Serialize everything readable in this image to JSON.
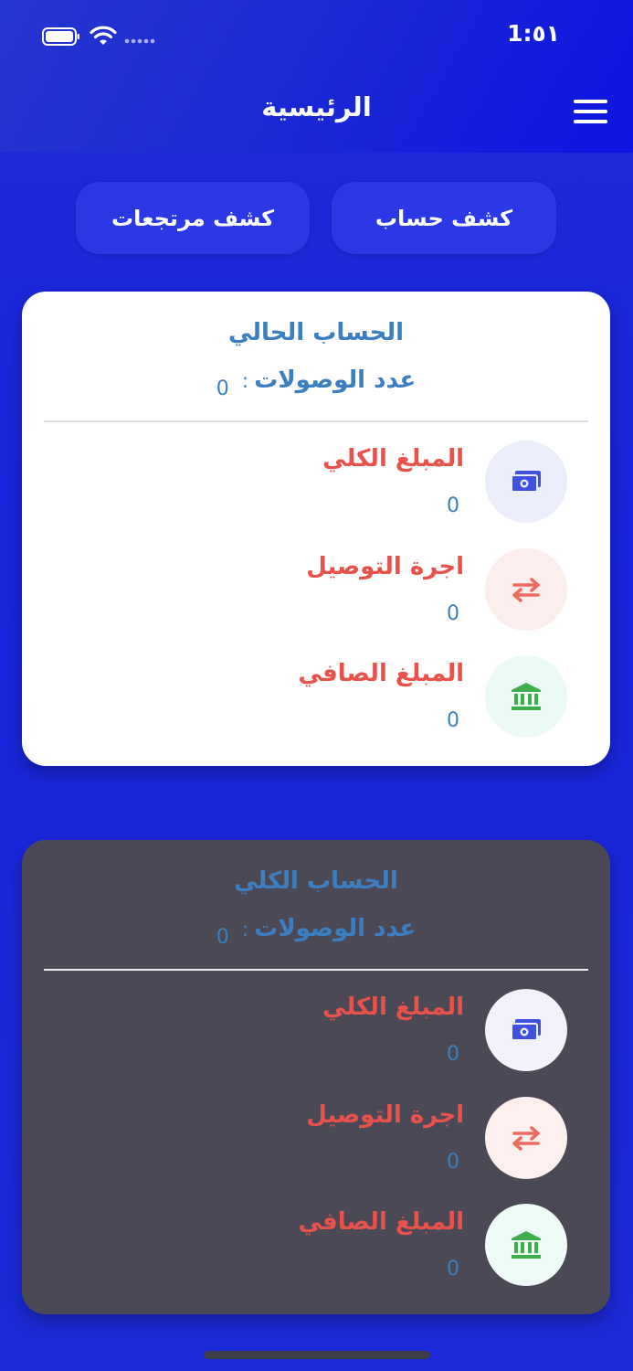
{
  "status_bar": {
    "time": "1:٥١"
  },
  "header": {
    "title": "الرئيسية"
  },
  "actions": {
    "account_statement": "كشف حساب",
    "returns_statement": "كشف مرتجعات"
  },
  "current_account": {
    "title": "الحساب الحالي",
    "receipts_label": "عدد الوصولات",
    "receipts_colon": ":",
    "receipts_value": "0",
    "rows": [
      {
        "label": "المبلغ الكلي",
        "value": "0",
        "icon": "cash-icon"
      },
      {
        "label": "اجرة التوصيل",
        "value": "0",
        "icon": "transfer-arrows-icon"
      },
      {
        "label": "المبلغ الصافي",
        "value": "0",
        "icon": "bank-icon"
      }
    ]
  },
  "total_account": {
    "title": "الحساب الكلي",
    "receipts_label": "عدد الوصولات",
    "receipts_colon": ":",
    "receipts_value": "0",
    "rows": [
      {
        "label": "المبلغ الكلي",
        "value": "0",
        "icon": "cash-icon"
      },
      {
        "label": "اجرة التوصيل",
        "value": "0",
        "icon": "transfer-arrows-icon"
      },
      {
        "label": "المبلغ الصافي",
        "value": "0",
        "icon": "bank-icon"
      }
    ]
  },
  "colors": {
    "background": "#1a24d6",
    "button": "#2b38e6",
    "label_red": "#e9514b",
    "value_blue": "#3b7fc0",
    "icon_blue": "#3f51e0",
    "icon_red": "#ef6a5e",
    "icon_green": "#3cae4a",
    "dark_card": "#4a4955"
  }
}
